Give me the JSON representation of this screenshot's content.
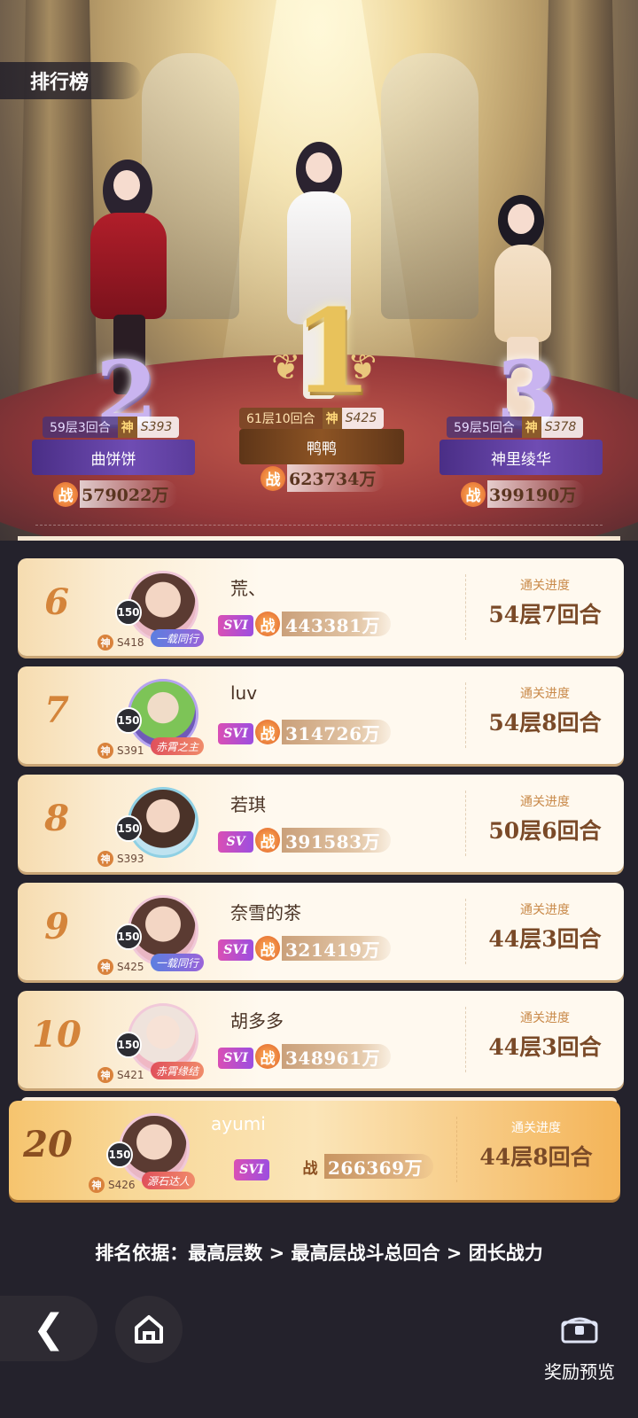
{
  "header": {
    "title": "排行榜"
  },
  "podium": [
    {
      "rank": "2",
      "floor": "59层3回合",
      "god": "神",
      "server": "S393",
      "name": "曲饼饼",
      "power_prefix": "战",
      "power": "579022万"
    },
    {
      "rank": "1",
      "floor": "61层10回合",
      "god": "神",
      "server": "S425",
      "name": "鸭鸭",
      "power_prefix": "战",
      "power": "623734万"
    },
    {
      "rank": "3",
      "floor": "59层5回合",
      "god": "神",
      "server": "S378",
      "name": "神里绫华",
      "power_prefix": "战",
      "power": "399190万"
    }
  ],
  "list": {
    "progress_label": "通关进度",
    "power_prefix": "战",
    "rows": [
      {
        "rank": "6",
        "level": "150",
        "god": "神",
        "server": "S418",
        "frame": "一载同行",
        "name": "荒、",
        "vip": "SVI",
        "power": "443381万",
        "progress": "54层7回合"
      },
      {
        "rank": "7",
        "level": "150",
        "god": "神",
        "server": "S391",
        "frame": "赤霄之主",
        "name": "luv",
        "vip": "SVI",
        "power": "314726万",
        "progress": "54层8回合"
      },
      {
        "rank": "8",
        "level": "150",
        "god": "神",
        "server": "S393",
        "frame": "",
        "name": "若琪",
        "vip": "SV",
        "power": "391583万",
        "progress": "50层6回合"
      },
      {
        "rank": "9",
        "level": "150",
        "god": "神",
        "server": "S425",
        "frame": "一载同行",
        "name": "奈雪的茶",
        "vip": "SVI",
        "power": "321419万",
        "progress": "44层3回合"
      },
      {
        "rank": "10",
        "level": "150",
        "god": "神",
        "server": "S421",
        "frame": "赤霄缘结",
        "name": "胡多多",
        "vip": "SVI",
        "power": "348961万",
        "progress": "44层3回合"
      }
    ]
  },
  "my_rank": {
    "rank": "20",
    "level": "150",
    "god": "神",
    "server": "S426",
    "frame": "源石达人",
    "name": "ayumi",
    "vip": "SVI",
    "power": "266369万",
    "progress": "44层8回合"
  },
  "footer": {
    "rule": "排名依据：最高层数 > 最高层战斗总回合 > 团长战力",
    "reward_label": "奖励预览"
  },
  "colors": {
    "rank_orange": "#d4843a",
    "purple_plate": "#5a3b9a",
    "gold_plate": "#8d5424",
    "background": "#24222c"
  },
  "icons": {
    "back": "chevron-left-icon",
    "home": "home-icon",
    "reward": "reward-chest-icon"
  }
}
